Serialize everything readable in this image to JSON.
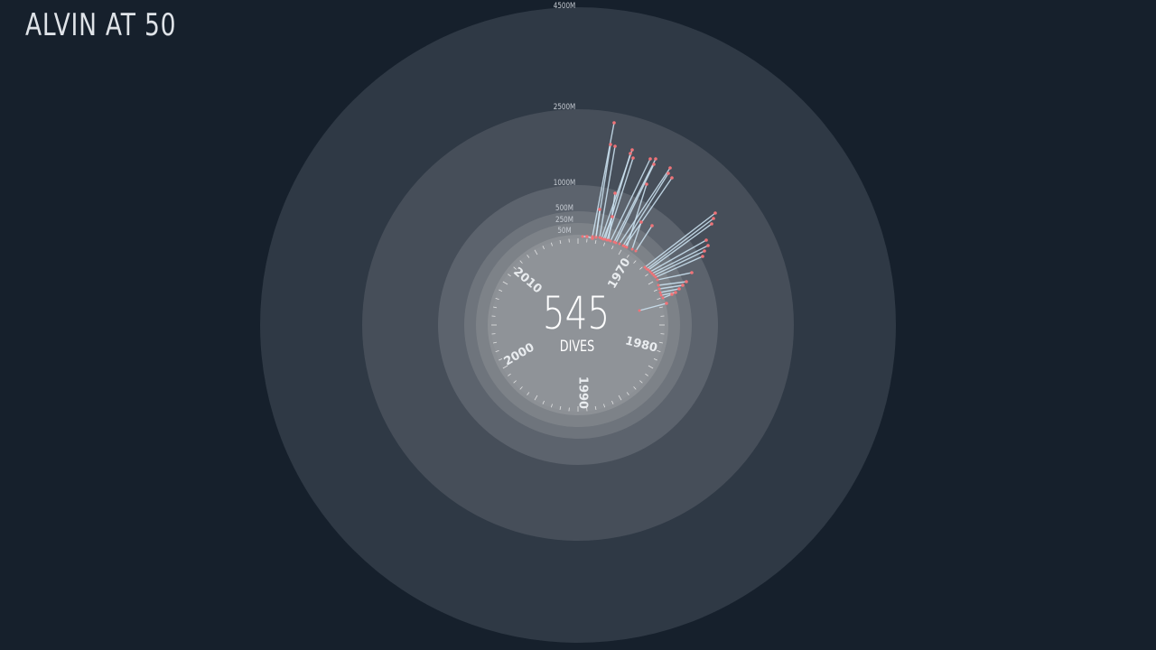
{
  "app": {
    "title": "ALVIN AT 50"
  },
  "center": {
    "count": "545",
    "label": "DIVES"
  },
  "depth_rings": [
    {
      "label": "4500M",
      "fill": "#2f3945"
    },
    {
      "label": "2500M",
      "fill": "#464e59"
    },
    {
      "label": "1000M",
      "fill": "#5c636d"
    },
    {
      "label": "500M",
      "fill": "#6e747c"
    },
    {
      "label": "250M",
      "fill": "#7d8288"
    },
    {
      "label": "50M",
      "fill": "#8c9095"
    }
  ],
  "year_labels": [
    "1970",
    "1980",
    "1990",
    "2000",
    "2010"
  ],
  "colors": {
    "background": "#16202c",
    "line": "#cfe6f5",
    "dot": "#f07378",
    "tick": "#f2f2f2"
  }
}
